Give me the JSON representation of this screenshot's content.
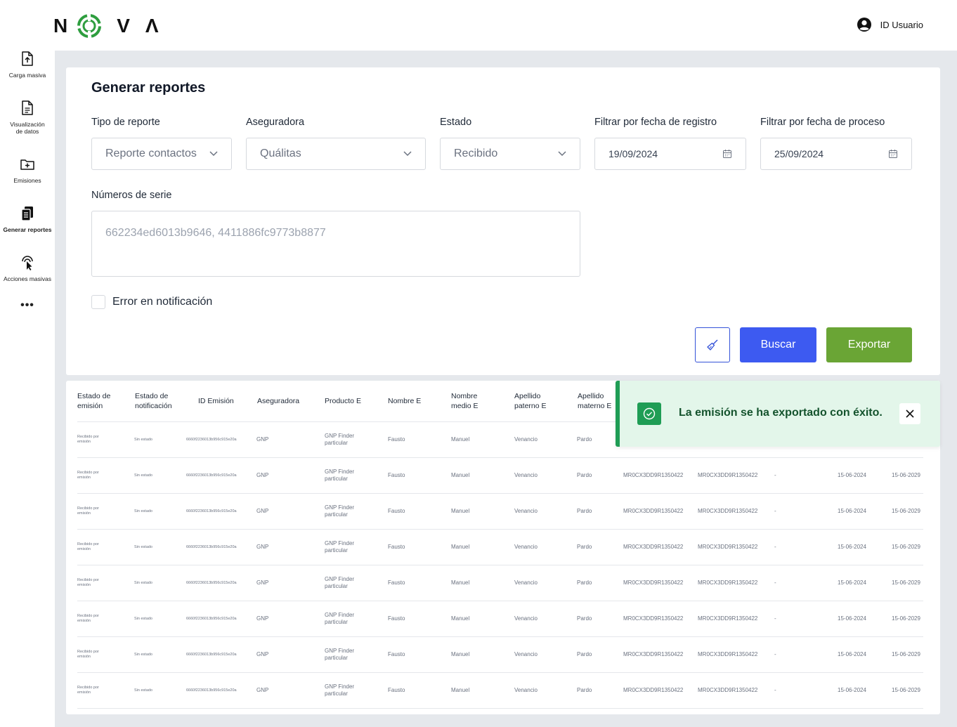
{
  "brand": {
    "letters": [
      "N",
      "O",
      "V",
      "Λ"
    ]
  },
  "user": {
    "label": "ID Usuario"
  },
  "sidebar": {
    "items": [
      {
        "label": "Carga masiva",
        "icon": "file-upload-icon"
      },
      {
        "label": "Visualización de datos",
        "icon": "file-text-icon"
      },
      {
        "label": "Emisiones",
        "icon": "folder-plus-icon"
      },
      {
        "label": "Generar reportes",
        "icon": "clipboard-stack-icon",
        "active": true
      },
      {
        "label": "Acciones masivas",
        "icon": "tap-icon"
      }
    ],
    "more": "•••"
  },
  "form": {
    "title": "Generar reportes",
    "tipo_label": "Tipo de reporte",
    "tipo_value": "Reporte contactos",
    "aseguradora_label": "Aseguradora",
    "aseguradora_value": "Quálitas",
    "estado_label": "Estado",
    "estado_value": "Recibido",
    "fecha_registro_label": "Filtrar por fecha de registro",
    "fecha_registro_value": "19/09/2024",
    "fecha_proceso_label": "Filtrar por fecha de proceso",
    "fecha_proceso_value": "25/09/2024",
    "series_label": "Números de serie",
    "series_placeholder": "662234ed6013b9646, 4411886fc9773b8877",
    "error_label": "Error en notificación",
    "buscar_label": "Buscar",
    "exportar_label": "Exportar"
  },
  "table": {
    "headers": {
      "estado_emision": "Estado de emisión",
      "estado_notificacion": "Estado de notificación",
      "id_emision": "ID Emisión",
      "aseguradora": "Aseguradora",
      "producto": "Producto E",
      "nombre": "Nombre E",
      "nombre_medio": "Nombre medio E",
      "apellido_paterno": "Apellido paterno E",
      "apellido_materno": "Apellido materno E"
    },
    "rows": [
      {
        "estado": "Recibido por emisión",
        "notif": "Sin estado",
        "id": "6660f2236013b956c915e20a",
        "aseg": "GNP",
        "prod": "GNP Finder particular",
        "nombre": "Fausto",
        "medio": "Manuel",
        "paterno": "Venancio",
        "materno": "Pardo",
        "serie1": "",
        "serie2": "",
        "guion": "",
        "f1": "",
        "f2": ""
      },
      {
        "estado": "Recibido por emisión",
        "notif": "Sin estado",
        "id": "6660f2236013b956c915e20a",
        "aseg": "GNP",
        "prod": "GNP Finder particular",
        "nombre": "Fausto",
        "medio": "Manuel",
        "paterno": "Venancio",
        "materno": "Pardo",
        "serie1": "MR0CX3DD9R1350422",
        "serie2": "MR0CX3DD9R1350422",
        "guion": "-",
        "f1": "15-06-2024",
        "f2": "15-06-2029"
      },
      {
        "estado": "Recibido por emisión",
        "notif": "Sin estado",
        "id": "6660f2236013b956c915e20a",
        "aseg": "GNP",
        "prod": "GNP Finder particular",
        "nombre": "Fausto",
        "medio": "Manuel",
        "paterno": "Venancio",
        "materno": "Pardo",
        "serie1": "MR0CX3DD9R1350422",
        "serie2": "MR0CX3DD9R1350422",
        "guion": "-",
        "f1": "15-06-2024",
        "f2": "15-06-2029"
      },
      {
        "estado": "Recibido por emisión",
        "notif": "Sin estado",
        "id": "6660f2236013b956c915e20a",
        "aseg": "GNP",
        "prod": "GNP Finder particular",
        "nombre": "Fausto",
        "medio": "Manuel",
        "paterno": "Venancio",
        "materno": "Pardo",
        "serie1": "MR0CX3DD9R1350422",
        "serie2": "MR0CX3DD9R1350422",
        "guion": "-",
        "f1": "15-06-2024",
        "f2": "15-06-2029"
      },
      {
        "estado": "Recibido por emisión",
        "notif": "Sin estado",
        "id": "6660f2236013b956c915e20a",
        "aseg": "GNP",
        "prod": "GNP Finder particular",
        "nombre": "Fausto",
        "medio": "Manuel",
        "paterno": "Venancio",
        "materno": "Pardo",
        "serie1": "MR0CX3DD9R1350422",
        "serie2": "MR0CX3DD9R1350422",
        "guion": "-",
        "f1": "15-06-2024",
        "f2": "15-06-2029"
      },
      {
        "estado": "Recibido por emisión",
        "notif": "Sin estado",
        "id": "6660f2236013b956c915e20a",
        "aseg": "GNP",
        "prod": "GNP Finder particular",
        "nombre": "Fausto",
        "medio": "Manuel",
        "paterno": "Venancio",
        "materno": "Pardo",
        "serie1": "MR0CX3DD9R1350422",
        "serie2": "MR0CX3DD9R1350422",
        "guion": "-",
        "f1": "15-06-2024",
        "f2": "15-06-2029"
      },
      {
        "estado": "Recibido por emisión",
        "notif": "Sin estado",
        "id": "6660f2236013b956c915e20a",
        "aseg": "GNP",
        "prod": "GNP Finder particular",
        "nombre": "Fausto",
        "medio": "Manuel",
        "paterno": "Venancio",
        "materno": "Pardo",
        "serie1": "MR0CX3DD9R1350422",
        "serie2": "MR0CX3DD9R1350422",
        "guion": "-",
        "f1": "15-06-2024",
        "f2": "15-06-2029"
      },
      {
        "estado": "Recibido por emisión",
        "notif": "Sin estado",
        "id": "6660f2236013b956c915e20a",
        "aseg": "GNP",
        "prod": "GNP Finder particular",
        "nombre": "Fausto",
        "medio": "Manuel",
        "paterno": "Venancio",
        "materno": "Pardo",
        "serie1": "MR0CX3DD9R1350422",
        "serie2": "MR0CX3DD9R1350422",
        "guion": "-",
        "f1": "15-06-2024",
        "f2": "15-06-2029"
      }
    ]
  },
  "toast": {
    "message": "La emisión se ha exportado con éxito.",
    "icon": "check-circle-icon",
    "close_icon": "close-icon"
  },
  "colors": {
    "primary": "#3d5af1",
    "export": "#6aa535",
    "success": "#1f9d55",
    "success_bg": "#e3f6ea",
    "logo_green": "#2e9e3f",
    "background": "#e5e8ec"
  }
}
